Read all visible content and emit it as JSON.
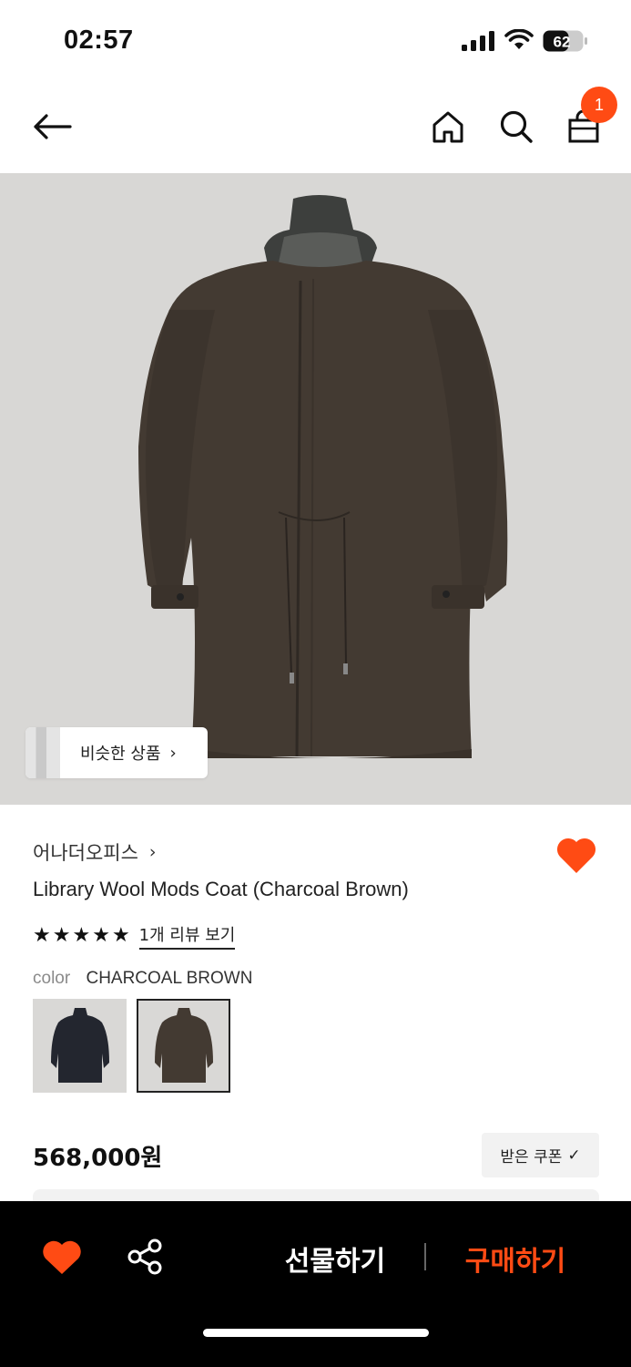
{
  "status_bar": {
    "time": "02:57",
    "battery": "62"
  },
  "nav": {
    "back_icon": "arrow-left-icon",
    "home_icon": "home-icon",
    "search_icon": "search-icon",
    "cart_icon": "shopping-bag-icon",
    "cart_count": "1"
  },
  "hero": {
    "similar_label": "비슷한 상품"
  },
  "product": {
    "brand": "어나더오피스",
    "title": "Library Wool Mods Coat (Charcoal Brown)",
    "rating_stars": 5,
    "review_link": "1개 리뷰 보기",
    "color_label": "color",
    "color_value": "CHARCOAL BROWN",
    "price": "568,000원",
    "coupon_label": "받은 쿠폰"
  },
  "bottom_bar": {
    "gift_label": "선물하기",
    "buy_label": "구매하기"
  },
  "colors": {
    "accent": "#ff4b14",
    "background": "#ffffff",
    "bottom_bar": "#000000",
    "hero_bg": "#d8d7d5",
    "coat_brown": "#433a32",
    "coat_navy": "#23262f"
  }
}
